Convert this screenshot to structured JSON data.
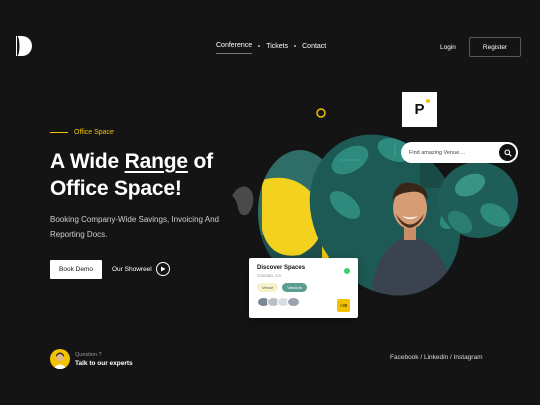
{
  "nav": {
    "items": [
      {
        "label": "Conference",
        "active": true
      },
      {
        "label": "Tickets",
        "active": false
      },
      {
        "label": "Contact",
        "active": false
      }
    ],
    "login_label": "Login",
    "register_label": "Register"
  },
  "hero": {
    "eyebrow": "Office Space",
    "headline_part1": "A Wide ",
    "headline_underlined": "Range",
    "headline_part2": " of",
    "headline_line2": "Office Space!",
    "description": "Booking Company-Wide Savings, Invoicing And Reporting Docs.",
    "book_demo_label": "Book Demo",
    "showreel_label": "Our Showreel"
  },
  "help": {
    "question": "Question ?",
    "talk_label": "Talk to our experts"
  },
  "footer": {
    "social": "Facebook / Linkedin / Instagram"
  },
  "search": {
    "placeholder": "Find amazing Venue...."
  },
  "brand_card": {
    "letter": "P"
  },
  "discover_card": {
    "title": "Discover Spaces",
    "location": "Canada, CA",
    "tags": [
      "Venue",
      "Vendors"
    ],
    "count": "+39"
  },
  "colors": {
    "background": "#141414",
    "accent": "#f2c200",
    "teal": "#2f7b73",
    "status_green": "#3ccf6e"
  },
  "icons": [
    "logo-icon",
    "play-icon",
    "search-icon",
    "status-dot-icon"
  ]
}
